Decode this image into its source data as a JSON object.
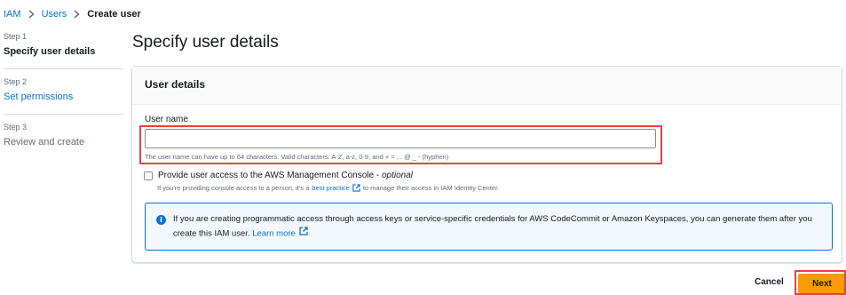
{
  "breadcrumb": {
    "items": [
      {
        "label": "IAM"
      },
      {
        "label": "Users"
      },
      {
        "label": "Create user"
      }
    ]
  },
  "steps": [
    {
      "number": "Step 1",
      "title": "Specify user details",
      "state": "active"
    },
    {
      "number": "Step 2",
      "title": "Set permissions",
      "state": "link"
    },
    {
      "number": "Step 3",
      "title": "Review and create",
      "state": "disabled"
    }
  ],
  "page": {
    "title": "Specify user details"
  },
  "user_details": {
    "header": "User details",
    "username_label": "User name",
    "username_value": "",
    "username_constraint": "The user name can have up to 64 characters. Valid characters: A-Z, a-z, 0-9, and + = , . @ _ - (hyphen)",
    "console_access_label": "Provide user access to the AWS Management Console - ",
    "console_access_optional": "optional",
    "console_access_desc_prefix": "If you're providing console access to a person, it's a",
    "console_access_desc_link": "best practice",
    "console_access_desc_suffix": "to manage their access in IAM Identity Center.",
    "info_text": "If you are creating programmatic access through access keys or service-specific credentials for AWS CodeCommit or Amazon Keyspaces, you can generate them after you create this IAM user.",
    "info_link": "Learn more"
  },
  "actions": {
    "cancel": "Cancel",
    "next": "Next"
  },
  "colors": {
    "link": "#0972d3",
    "primary_button": "#ff9900",
    "highlight": "#e74242"
  }
}
